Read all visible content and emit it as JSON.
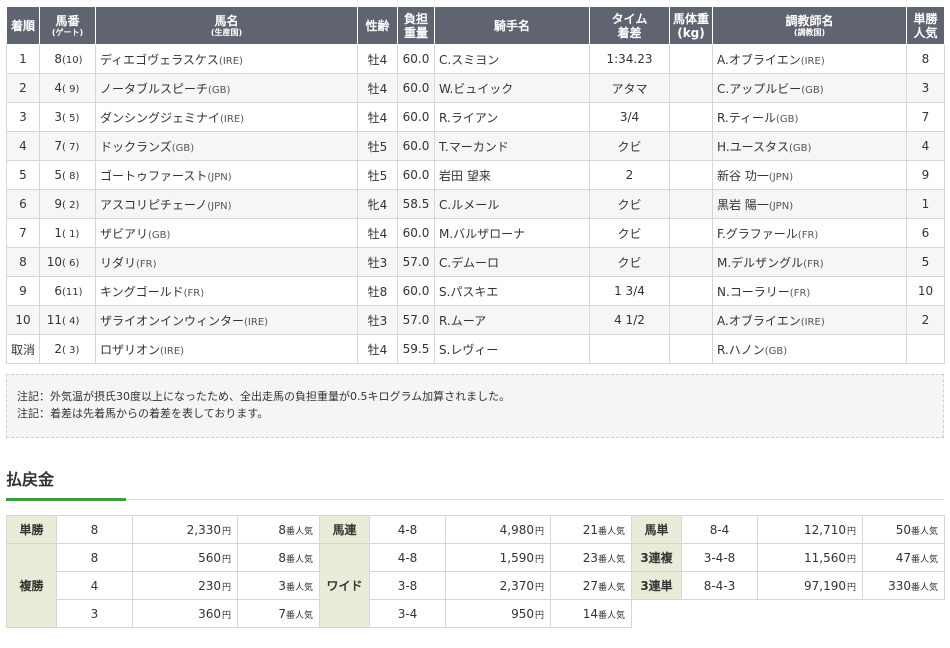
{
  "headers": {
    "rank": "着順",
    "num_l1": "馬番",
    "num_l2": "(ゲート)",
    "horse_l1": "馬名",
    "horse_l2": "(生産国)",
    "sexage": "性齢",
    "weight_l1": "負担",
    "weight_l2": "重量",
    "jockey": "騎手名",
    "time_l1": "タイム",
    "time_l2": "着差",
    "body_l1": "馬体重",
    "body_l2": "(kg)",
    "trainer_l1": "調教師名",
    "trainer_l2": "(調教国)",
    "pop_l1": "単勝",
    "pop_l2": "人気"
  },
  "rows": [
    {
      "rank": "1",
      "num": "8",
      "gate": "(10)",
      "horse": "ディエゴヴェラスケス",
      "horse_c": "(IRE)",
      "sex": "牡4",
      "weight": "60.0",
      "jockey": "C.スミヨン",
      "time": "1:34.23",
      "body": "",
      "trainer": "A.オブライエン",
      "trainer_c": "(IRE)",
      "pop": "8"
    },
    {
      "rank": "2",
      "num": "4",
      "gate": "( 9)",
      "horse": "ノータブルスピーチ",
      "horse_c": "(GB)",
      "sex": "牡4",
      "weight": "60.0",
      "jockey": "W.ビュイック",
      "time": "アタマ",
      "body": "",
      "trainer": "C.アップルビー",
      "trainer_c": "(GB)",
      "pop": "3"
    },
    {
      "rank": "3",
      "num": "3",
      "gate": "( 5)",
      "horse": "ダンシングジェミナイ",
      "horse_c": "(IRE)",
      "sex": "牡4",
      "weight": "60.0",
      "jockey": "R.ライアン",
      "time": "3/4",
      "body": "",
      "trainer": "R.ティール",
      "trainer_c": "(GB)",
      "pop": "7"
    },
    {
      "rank": "4",
      "num": "7",
      "gate": "( 7)",
      "horse": "ドックランズ",
      "horse_c": "(GB)",
      "sex": "牡5",
      "weight": "60.0",
      "jockey": "T.マーカンド",
      "time": "クビ",
      "body": "",
      "trainer": "H.ユースタス",
      "trainer_c": "(GB)",
      "pop": "4"
    },
    {
      "rank": "5",
      "num": "5",
      "gate": "( 8)",
      "horse": "ゴートゥファースト",
      "horse_c": "(JPN)",
      "sex": "牡5",
      "weight": "60.0",
      "jockey": "岩田 望来",
      "time": "2",
      "body": "",
      "trainer": "新谷 功一",
      "trainer_c": "(JPN)",
      "pop": "9"
    },
    {
      "rank": "6",
      "num": "9",
      "gate": "( 2)",
      "horse": "アスコリピチェーノ",
      "horse_c": "(JPN)",
      "sex": "牝4",
      "weight": "58.5",
      "jockey": "C.ルメール",
      "time": "クビ",
      "body": "",
      "trainer": "黒岩 陽一",
      "trainer_c": "(JPN)",
      "pop": "1"
    },
    {
      "rank": "7",
      "num": "1",
      "gate": "( 1)",
      "horse": "ザビアリ",
      "horse_c": "(GB)",
      "sex": "牡4",
      "weight": "60.0",
      "jockey": "M.バルザローナ",
      "time": "クビ",
      "body": "",
      "trainer": "F.グラファール",
      "trainer_c": "(FR)",
      "pop": "6"
    },
    {
      "rank": "8",
      "num": "10",
      "gate": "( 6)",
      "horse": "リダリ",
      "horse_c": "(FR)",
      "sex": "牡3",
      "weight": "57.0",
      "jockey": "C.デムーロ",
      "time": "クビ",
      "body": "",
      "trainer": "M.デルザングル",
      "trainer_c": "(FR)",
      "pop": "5"
    },
    {
      "rank": "9",
      "num": "6",
      "gate": "(11)",
      "horse": "キングゴールド",
      "horse_c": "(FR)",
      "sex": "牡8",
      "weight": "60.0",
      "jockey": "S.パスキエ",
      "time": "1 3/4",
      "body": "",
      "trainer": "N.コーラリー",
      "trainer_c": "(FR)",
      "pop": "10"
    },
    {
      "rank": "10",
      "num": "11",
      "gate": "( 4)",
      "horse": "ザライオンインウィンター",
      "horse_c": "(IRE)",
      "sex": "牡3",
      "weight": "57.0",
      "jockey": "R.ムーア",
      "time": "4 1/2",
      "body": "",
      "trainer": "A.オブライエン",
      "trainer_c": "(IRE)",
      "pop": "2"
    },
    {
      "rank": "取消",
      "num": "2",
      "gate": "( 3)",
      "horse": "ロザリオン",
      "horse_c": "(IRE)",
      "sex": "牡4",
      "weight": "59.5",
      "jockey": "S.レヴィー",
      "time": "",
      "body": "",
      "trainer": "R.ハノン",
      "trainer_c": "(GB)",
      "pop": ""
    }
  ],
  "notes": [
    "注記：外気温が摂氏30度以上になったため、全出走馬の負担重量が0.5キログラム加算されました。",
    "注記：着差は先着馬からの着差を表しております。"
  ],
  "payout_title": "払戻金",
  "yen": "円",
  "pop_suffix": "番人気",
  "payouts": {
    "tansho": {
      "label": "単勝",
      "rows": [
        {
          "combo": "8",
          "amount": "2,330",
          "pop": "8"
        }
      ]
    },
    "fukusho": {
      "label": "複勝",
      "rows": [
        {
          "combo": "8",
          "amount": "560",
          "pop": "8"
        },
        {
          "combo": "4",
          "amount": "230",
          "pop": "3"
        },
        {
          "combo": "3",
          "amount": "360",
          "pop": "7"
        }
      ]
    },
    "umaren": {
      "label": "馬連",
      "rows": [
        {
          "combo": "4-8",
          "amount": "4,980",
          "pop": "21"
        }
      ]
    },
    "wide": {
      "label": "ワイド",
      "rows": [
        {
          "combo": "4-8",
          "amount": "1,590",
          "pop": "23"
        },
        {
          "combo": "3-8",
          "amount": "2,370",
          "pop": "27"
        },
        {
          "combo": "3-4",
          "amount": "950",
          "pop": "14"
        }
      ]
    },
    "umatan": {
      "label": "馬単",
      "rows": [
        {
          "combo": "8-4",
          "amount": "12,710",
          "pop": "50"
        }
      ]
    },
    "sanrenpuku": {
      "label": "3連複",
      "rows": [
        {
          "combo": "3-4-8",
          "amount": "11,560",
          "pop": "47"
        }
      ]
    },
    "sanrentan": {
      "label": "3連単",
      "rows": [
        {
          "combo": "8-4-3",
          "amount": "97,190",
          "pop": "330"
        }
      ]
    }
  },
  "colors": {
    "header_bg": "#5f6470",
    "label_bg": "#e8ecd8",
    "accent": "#3a9d3a"
  }
}
